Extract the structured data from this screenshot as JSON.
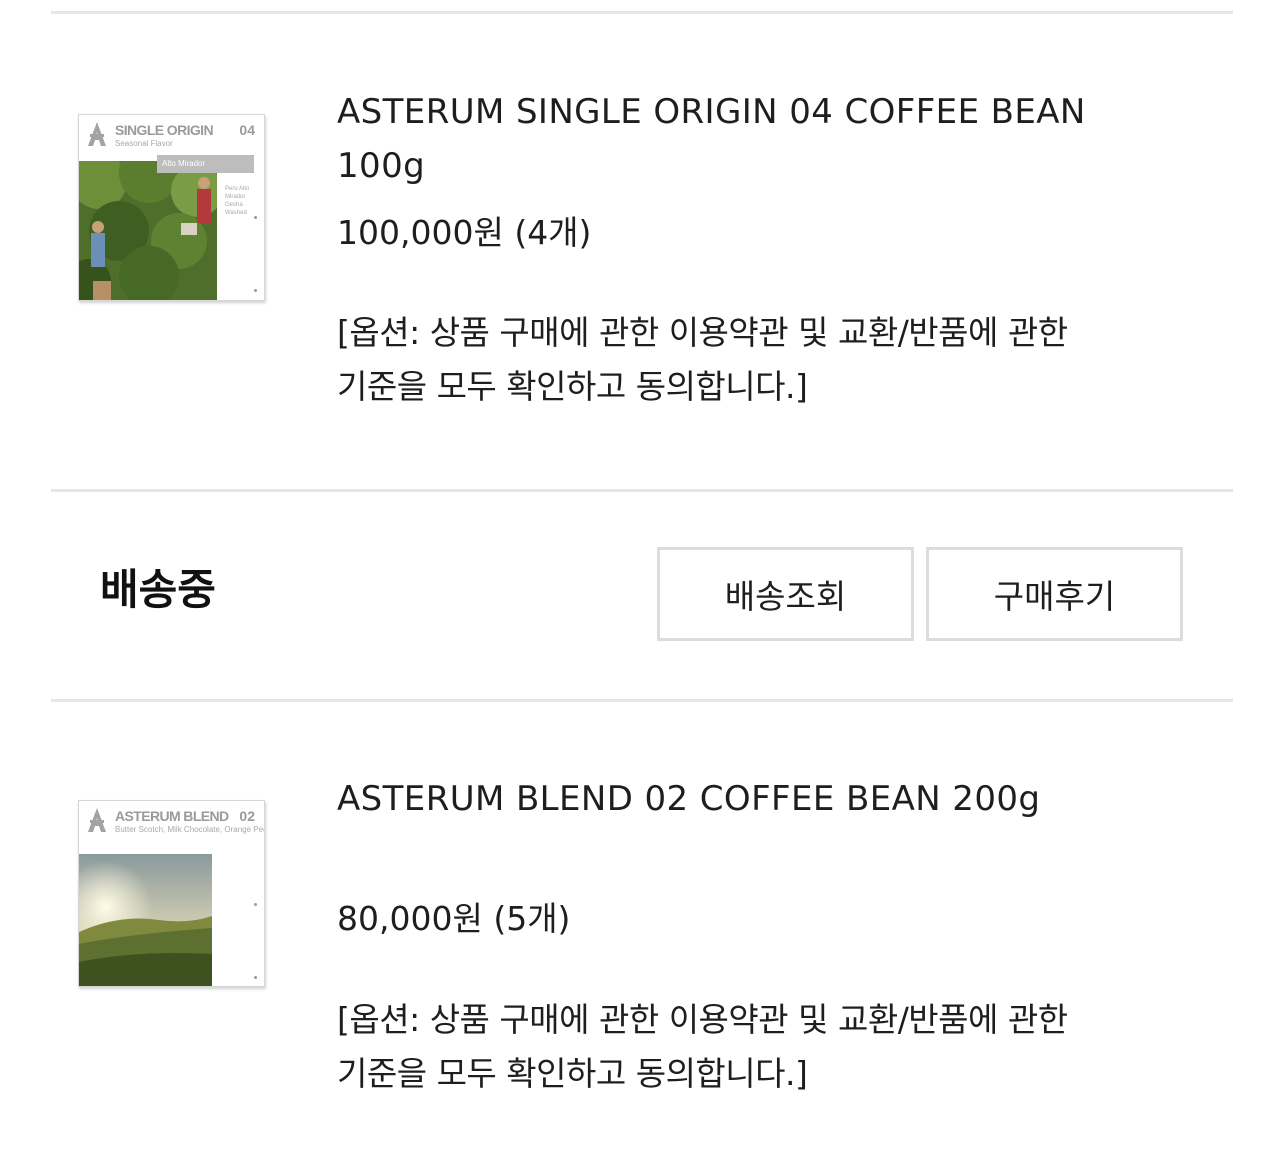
{
  "orders": [
    {
      "name": "ASTERUM SINGLE ORIGIN 04 COFFEE BEAN 100g",
      "price": "100,000원 (4개)",
      "option": "[옵션: 상품 구매에 관한 이용약관 및 교환/반품에 관한 기준을 모두 확인하고 동의합니다.]",
      "thumbnail": {
        "title": "SINGLE ORIGIN",
        "number": "04",
        "subtitle": "Seasonal Flavor",
        "tag": "Alto Mirador",
        "notes": "Peru Alto Mirador Gesha Washed"
      }
    },
    {
      "name": "ASTERUM BLEND 02 COFFEE BEAN 200g",
      "price": "80,000원 (5개)",
      "option": "[옵션: 상품 구매에 관한 이용약관 및 교환/반품에 관한 기준을 모두 확인하고 동의합니다.]",
      "thumbnail": {
        "title": "ASTERUM BLEND",
        "number": "02",
        "subtitle": "Butter Scotch, Milk Chocolate, Orange Peel"
      }
    }
  ],
  "shipment": {
    "status": "배송중",
    "track_button": "배송조회",
    "review_button": "구매후기"
  },
  "colors": {
    "divider": "#e6e6e6",
    "button_border": "#dcdcdc",
    "text": "#1e1e1e"
  }
}
